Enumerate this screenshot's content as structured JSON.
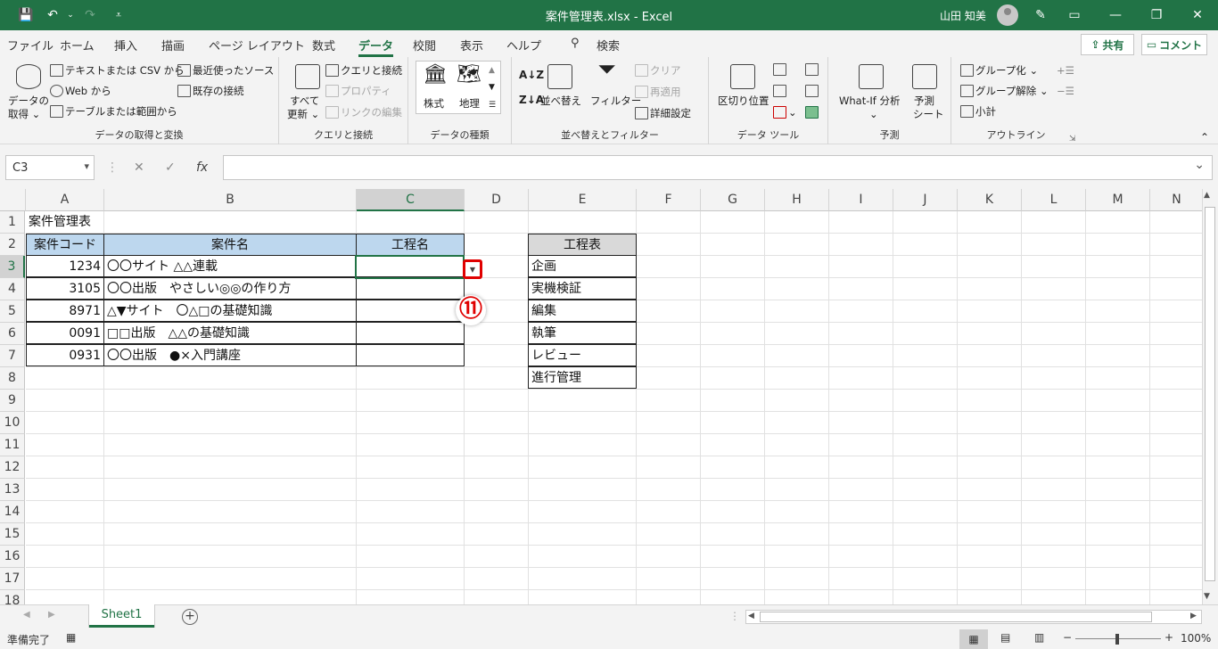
{
  "window": {
    "title": "案件管理表.xlsx  -  Excel",
    "user": "山田 知美"
  },
  "tabs": [
    "ファイル",
    "ホーム",
    "挿入",
    "描画",
    "ページ レイアウト",
    "数式",
    "データ",
    "校閲",
    "表示",
    "ヘルプ"
  ],
  "active_tab": "データ",
  "search_label": "検索",
  "share_label": "共有",
  "comment_label": "コメント",
  "ribbon": {
    "get_data": {
      "big_label": "データの",
      "big_label2": "取得 ⌄",
      "text_csv": "テキストまたは CSV から",
      "web": "Web から",
      "table_range": "テーブルまたは範囲から",
      "recent": "最近使ったソース",
      "existing": "既存の接続",
      "group": "データの取得と変換"
    },
    "queries": {
      "refresh": "すべて",
      "refresh2": "更新 ⌄",
      "queries_conn": "クエリと接続",
      "properties": "プロパティ",
      "edit_links": "リンクの編集",
      "group": "クエリと接続"
    },
    "types": {
      "stocks": "株式",
      "geo": "地理",
      "group": "データの種類"
    },
    "sort": {
      "sort": "並べ替え",
      "filter": "フィルター",
      "clear": "クリア",
      "reapply": "再適用",
      "advanced": "詳細設定",
      "group": "並べ替えとフィルター"
    },
    "tools": {
      "text_to_col": "区切り位置",
      "group": "データ ツール"
    },
    "forecast": {
      "whatif": "What-If 分析",
      "whatif2": "⌄",
      "sheet": "予測",
      "sheet2": "シート",
      "group": "予測"
    },
    "outline": {
      "group_btn": "グループ化",
      "ungroup": "グループ解除",
      "subtotal": "小計",
      "group": "アウトライン"
    }
  },
  "namebox": "C3",
  "columns": [
    "A",
    "B",
    "C",
    "D",
    "E",
    "F",
    "G",
    "H",
    "I",
    "J",
    "K",
    "L",
    "M",
    "N"
  ],
  "rows": [
    "1",
    "2",
    "3",
    "4",
    "5",
    "6",
    "7",
    "8",
    "9",
    "10",
    "11",
    "12",
    "13",
    "14",
    "15",
    "16",
    "17",
    "18"
  ],
  "sheet": {
    "title": "案件管理表",
    "headers": [
      "案件コード",
      "案件名",
      "工程名"
    ],
    "records": [
      {
        "code": "1234",
        "name": "〇〇サイト △△連載"
      },
      {
        "code": "3105",
        "name": "〇〇出版　やさしい◎◎の作り方"
      },
      {
        "code": "8971",
        "name": "△▼サイト　〇△□の基礎知識"
      },
      {
        "code": "0091",
        "name": "□□出版　△△の基礎知識"
      },
      {
        "code": "0931",
        "name": "〇〇出版　●×入門講座"
      }
    ],
    "process_header": "工程表",
    "processes": [
      "企画",
      "実機検証",
      "編集",
      "執筆",
      "レビュー",
      "進行管理"
    ]
  },
  "callout": "⑪",
  "sheet_tab": "Sheet1",
  "status": {
    "ready": "準備完了",
    "zoom": "100%"
  }
}
